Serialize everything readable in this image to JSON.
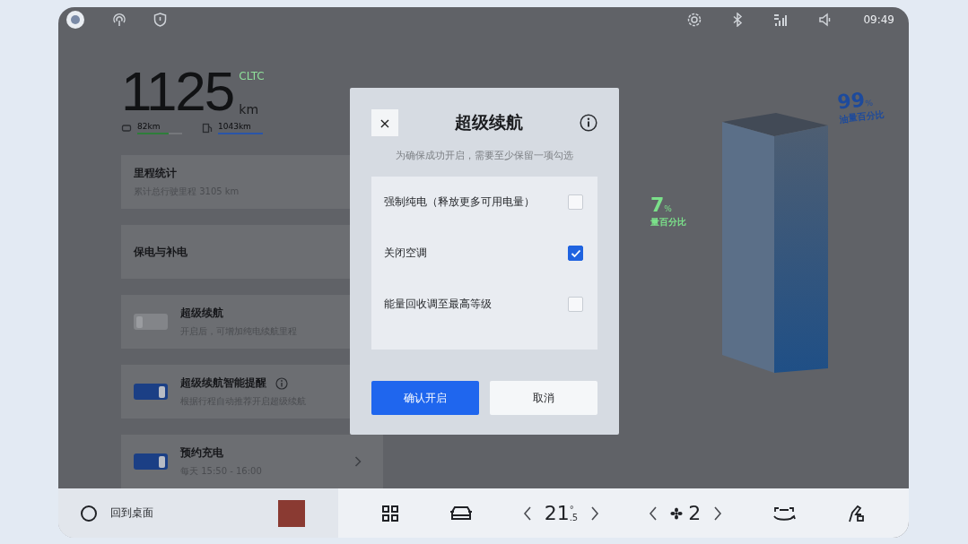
{
  "status_bar": {
    "time": "09:49"
  },
  "range": {
    "value": "1125",
    "standard": "CLTC",
    "unit": "km",
    "sources": [
      {
        "kind": "electric",
        "reading": "82km",
        "level": 0.7
      },
      {
        "kind": "fuel",
        "reading": "1043km",
        "level": 1
      }
    ]
  },
  "cards": [
    {
      "kind": "plain",
      "title": "里程统计",
      "subtitle": "累计总行驶里程 3105 km"
    },
    {
      "kind": "plain",
      "title": "保电与补电"
    },
    {
      "kind": "toggle",
      "title": "超级续航",
      "subtitle": "开启后，可增加纯电续航里程",
      "on": false,
      "info": false
    },
    {
      "kind": "toggle",
      "title": "超级续航智能提醒",
      "subtitle": "根据行程自动推荐开启超级续航",
      "on": true,
      "info": true
    },
    {
      "kind": "toggle",
      "title": "预约充电",
      "subtitle": "每天 15:50 - 16:00",
      "on": true,
      "info": false,
      "chevron": true
    }
  ],
  "gauge": {
    "fuel": {
      "value": "99",
      "unit": "%",
      "label": "油量百分比"
    },
    "battery": {
      "value": "7",
      "unit": "%",
      "label": "量百分比"
    }
  },
  "dialog": {
    "close": "×",
    "title": "超级续航",
    "hint": "为确保成功开启，需要至少保留一项勾选",
    "options": [
      {
        "label": "强制纯电（释放更多可用电量）",
        "checked": false
      },
      {
        "label": "关闭空调",
        "checked": true
      },
      {
        "label": "能量回收调至最高等级",
        "checked": false
      }
    ],
    "confirm": "确认开启",
    "cancel": "取消"
  },
  "dock": {
    "home": "回到桌面",
    "temperature": "21",
    "temperature_decimal": ".5",
    "degree": "°",
    "fan": "2"
  }
}
